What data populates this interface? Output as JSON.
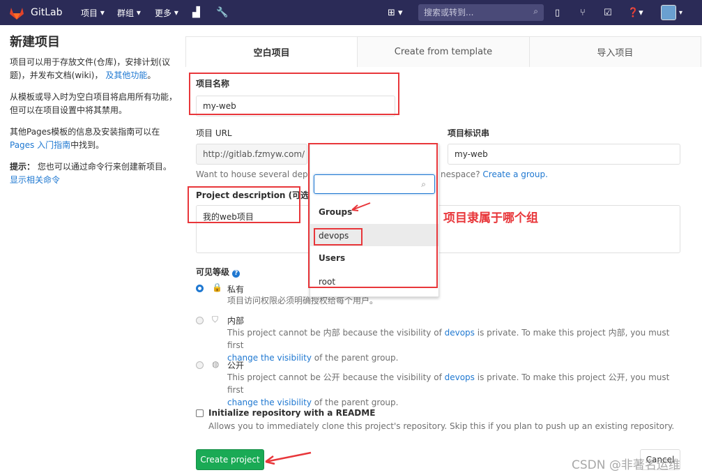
{
  "nav": {
    "brand": "GitLab",
    "items": [
      "项目",
      "群组",
      "更多"
    ],
    "search_placeholder": "搜索或转到..."
  },
  "sidebar": {
    "title": "新建项目",
    "p1": "项目可以用于存放文件(仓库)，安排计划(议题)，并发布文档(wiki)，",
    "p1_link": "及其他功能",
    "p1_end": "。",
    "p2": "从模板或导入时为空白项目将启用所有功能，但可以在项目设置中将其禁用。",
    "p3a": "其他Pages模板的信息及安装指南可以在",
    "p3_link": "Pages 入门指南",
    "p3b": "中找到。",
    "tip_label": "提示：",
    "tip": "您也可以通过命令行来创建新项目。",
    "tip_link": "显示相关命令"
  },
  "tabs": [
    "空白项目",
    "Create from template",
    "导入项目"
  ],
  "form": {
    "name_label": "项目名称",
    "name_value": "my-web",
    "url_label": "项目 URL",
    "url_prefix": "http://gitlab.fzmyw.com/",
    "namespace": "devops",
    "slug_label": "项目标识串",
    "slug_value": "my-web",
    "help_a": "Want to house several depe",
    "help_b": "nespace?",
    "help_link": "Create a group.",
    "desc_label": "Project description (可选)",
    "desc_value": "我的web项目",
    "vis_label": "可见等级"
  },
  "dropdown": {
    "groups_header": "Groups",
    "group_item": "devops",
    "users_header": "Users",
    "user_item": "root"
  },
  "visibility": [
    {
      "title": "私有",
      "desc": "项目访问权限必须明确授权给每个用户。"
    },
    {
      "title": "内部",
      "desc_a": "This project cannot be 内部 because the visibility of ",
      "desc_link": "devops",
      "desc_b": " is private. To make this project 内部, you must first",
      "desc_link2": "change the visibility",
      "desc_c": " of the parent group."
    },
    {
      "title": "公开",
      "desc_a": "This project cannot be 公开 because the visibility of ",
      "desc_link": "devops",
      "desc_b": " is private. To make this project 公开, you must first",
      "desc_link2": "change the visibility",
      "desc_c": " of the parent group."
    }
  ],
  "readme": {
    "label": "Initialize repository with a README",
    "desc": "Allows you to immediately clone this project's repository. Skip this if you plan to push up an existing repository."
  },
  "buttons": {
    "create": "Create project",
    "cancel": "Cancel"
  },
  "annotation": "项目隶属于哪个组",
  "watermark": "CSDN @非著名运维",
  "colors": {
    "nav_bg": "#2b2b57",
    "accent": "#1f78d1",
    "create_btn": "#1aaa55",
    "annotation_red": "#e8363a"
  }
}
